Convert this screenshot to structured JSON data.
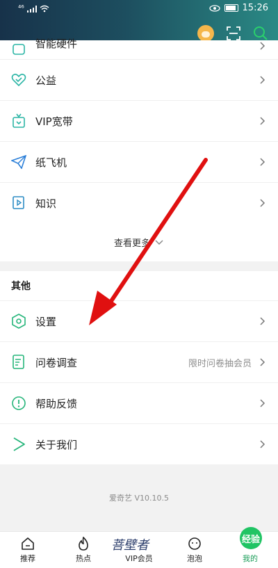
{
  "status_bar": {
    "signal": "⁴⁶",
    "time": "15:26"
  },
  "menu": {
    "items": [
      {
        "label": "智能硬件",
        "icon": "smart-hardware-icon",
        "hint": ""
      },
      {
        "label": "公益",
        "icon": "heart-check-icon",
        "hint": ""
      },
      {
        "label": "VIP宽带",
        "icon": "router-icon",
        "hint": ""
      },
      {
        "label": "纸飞机",
        "icon": "paper-plane-icon",
        "hint": ""
      },
      {
        "label": "知识",
        "icon": "book-play-icon",
        "hint": ""
      }
    ],
    "more_label": "查看更多"
  },
  "other": {
    "title": "其他",
    "items": [
      {
        "label": "设置",
        "icon": "settings-hexagon-icon",
        "hint": ""
      },
      {
        "label": "问卷调查",
        "icon": "survey-icon",
        "hint": "限时问卷抽会员"
      },
      {
        "label": "帮助反馈",
        "icon": "help-exclamation-icon",
        "hint": ""
      },
      {
        "label": "关于我们",
        "icon": "about-play-icon",
        "hint": ""
      }
    ]
  },
  "version": "爱奇艺 V10.10.5",
  "tabbar": {
    "tabs": [
      {
        "label": "推荐",
        "icon": "home-icon"
      },
      {
        "label": "热点",
        "icon": "flame-icon"
      },
      {
        "label": "VIP会员",
        "icon": "vip-logo-icon"
      },
      {
        "label": "泡泡",
        "icon": "bubble-face-icon"
      },
      {
        "label": "我的",
        "icon": "profile-icon"
      }
    ],
    "vip_logo_text": "菩壁者",
    "mine_badge": "经验"
  },
  "colors": {
    "accent": "#1c9e5a",
    "icon_teal": "#2bb5a5",
    "arrow": "#e01010"
  }
}
